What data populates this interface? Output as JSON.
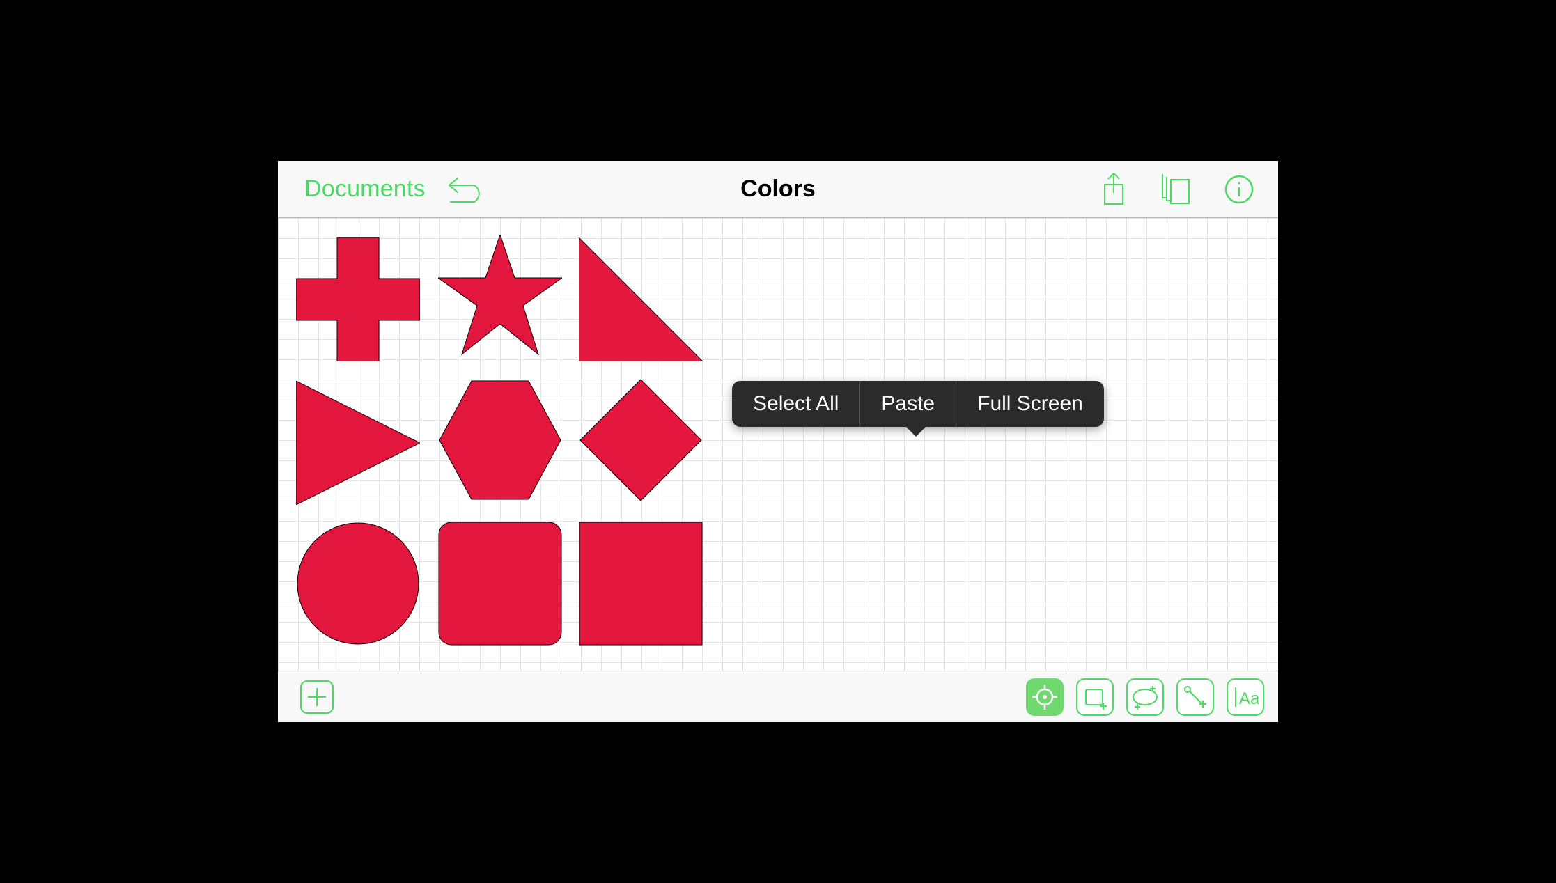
{
  "colors": {
    "accent": "#4CD964",
    "shapeFill": "#E3173E",
    "menuBg": "#2b2b2b"
  },
  "topbar": {
    "documents_label": "Documents",
    "title": "Colors"
  },
  "context_menu": {
    "select_all": "Select All",
    "paste": "Paste",
    "full_screen": "Full Screen"
  },
  "bottombar": {
    "text_tool_label": "Aa"
  },
  "shapes": [
    {
      "name": "cross"
    },
    {
      "name": "star"
    },
    {
      "name": "right-triangle"
    },
    {
      "name": "play-triangle"
    },
    {
      "name": "hexagon"
    },
    {
      "name": "diamond"
    },
    {
      "name": "circle"
    },
    {
      "name": "rounded-square"
    },
    {
      "name": "square"
    }
  ]
}
